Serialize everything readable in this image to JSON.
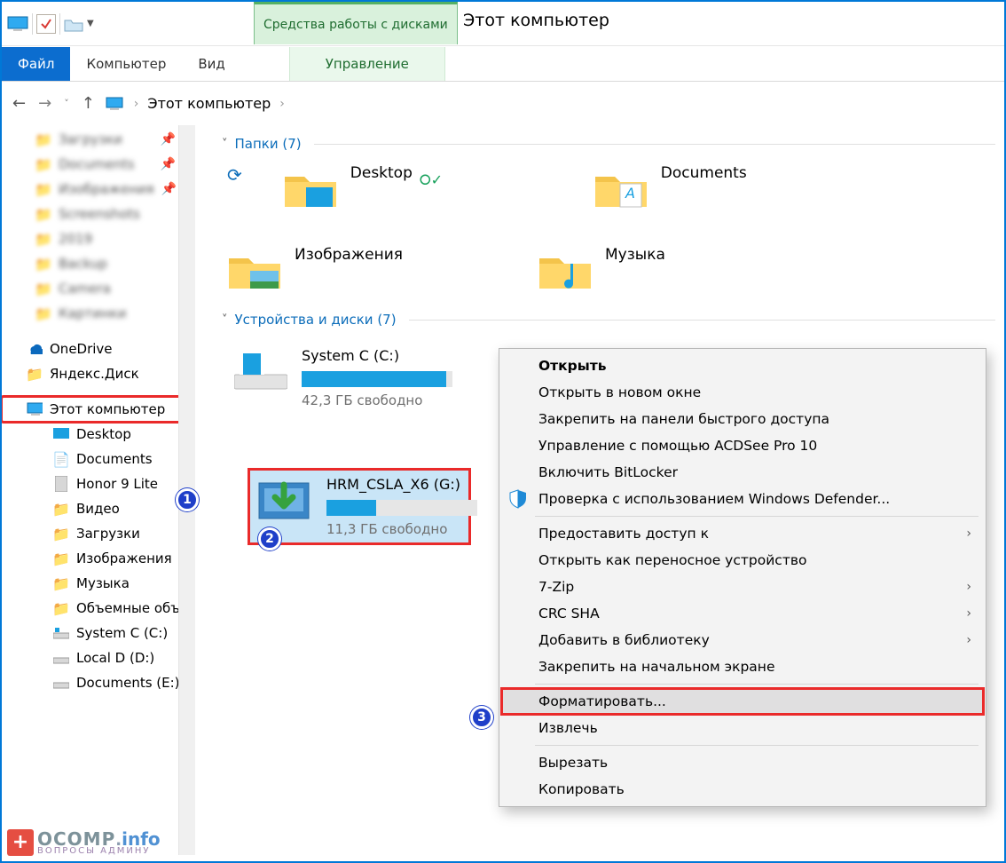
{
  "title": "Этот компьютер",
  "drive_tools_label": "Средства работы с дисками",
  "ribbon": {
    "file": "Файл",
    "computer": "Компьютер",
    "view": "Вид",
    "manage": "Управление"
  },
  "breadcrumb": {
    "root": "Этот компьютер"
  },
  "sidebar": {
    "pinned": [
      {
        "label": "Загрузки"
      },
      {
        "label": "Documents"
      },
      {
        "label": "Изображения"
      },
      {
        "label": "Screenshots"
      },
      {
        "label": "2019"
      },
      {
        "label": "Backup"
      },
      {
        "label": "Camera"
      },
      {
        "label": "Картинки"
      }
    ],
    "onedrive": "OneDrive",
    "yadisk": "Яндекс.Диск",
    "thispc": "Этот компьютер",
    "thispc_children": [
      {
        "label": "Desktop"
      },
      {
        "label": "Documents"
      },
      {
        "label": "Honor 9 Lite"
      },
      {
        "label": "Видео"
      },
      {
        "label": "Загрузки"
      },
      {
        "label": "Изображения"
      },
      {
        "label": "Музыка"
      },
      {
        "label": "Объемные объ"
      },
      {
        "label": "System C (C:)"
      },
      {
        "label": "Local D (D:)"
      },
      {
        "label": "Documents (E:)"
      }
    ]
  },
  "sections": {
    "folders_head": "Папки (7)",
    "drives_head": "Устройства и диски (7)"
  },
  "folders": [
    {
      "label": "Desktop"
    },
    {
      "label": "Documents"
    },
    {
      "label": "Изображения"
    },
    {
      "label": "Музыка"
    }
  ],
  "drives": {
    "c": {
      "name": "System C (C:)",
      "free": "42,3 ГБ свободно",
      "fill_pct": 96
    },
    "g": {
      "name": "HRM_CSLA_X6 (G:)",
      "free": "11,3 ГБ свободно",
      "fill_pct": 33
    }
  },
  "ctx": {
    "open": "Открыть",
    "open_new": "Открыть в новом окне",
    "pin_qa": "Закрепить на панели быстрого доступа",
    "acdsee": "Управление с помощью ACDSee Pro 10",
    "bitlocker": "Включить BitLocker",
    "defender": "Проверка с использованием Windows Defender...",
    "grant": "Предоставить доступ к",
    "portable": "Открыть как переносное устройство",
    "sevenzip": "7-Zip",
    "crc": "CRC SHA",
    "library": "Добавить в библиотеку",
    "pin_start": "Закрепить на начальном экране",
    "format": "Форматировать...",
    "eject": "Извлечь",
    "cut": "Вырезать",
    "copy": "Копировать"
  },
  "badges": {
    "one": "1",
    "two": "2",
    "three": "3"
  },
  "watermark": {
    "brand": "OCOMP",
    "dot": ".",
    "info": "info",
    "sub": "ВОПРОСЫ АДМИНУ"
  }
}
